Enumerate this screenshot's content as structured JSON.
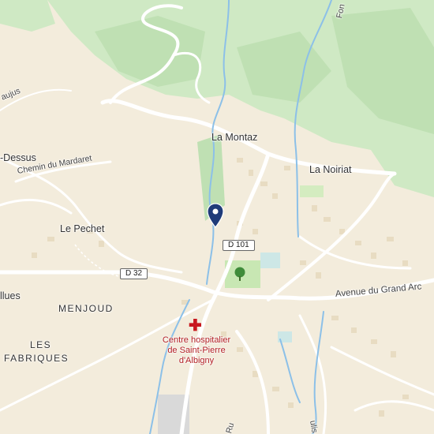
{
  "map": {
    "colors": {
      "land": "#f3ecdc",
      "forest": "#c9e6bf",
      "forest_dark": "#b9dcae",
      "road": "#ffffff",
      "river": "#8cc0e8",
      "pin": "#1f3b79",
      "hospital": "#b21e23",
      "park": "#c8e7b3"
    },
    "places": {
      "la_montaz": "La Montaz",
      "la_noiriat": "La Noiriat",
      "le_pechet": "Le Pechet",
      "dessus": "-Dessus",
      "menjoud": "MENJOUD",
      "les": "LES",
      "fabriques": "FABRIQUES",
      "allues": "llues"
    },
    "streets": {
      "chemin_mardaret": "Chemin du Mardaret",
      "avenue_grand_arc": "Avenue du Grand Arc",
      "aujus": "aujus",
      "fon": "Fon",
      "ru": "Ru",
      "ulis": "ulis"
    },
    "roads": {
      "d101": "D 101",
      "d32": "D 32"
    },
    "poi": {
      "hospital_icon": "hospital-cross-icon",
      "hospital_line1": "Centre hospitalier",
      "hospital_line2": "de Saint-Pierre",
      "hospital_line3": "d'Albigny"
    },
    "marker": {
      "icon": "location-pin-icon"
    }
  }
}
